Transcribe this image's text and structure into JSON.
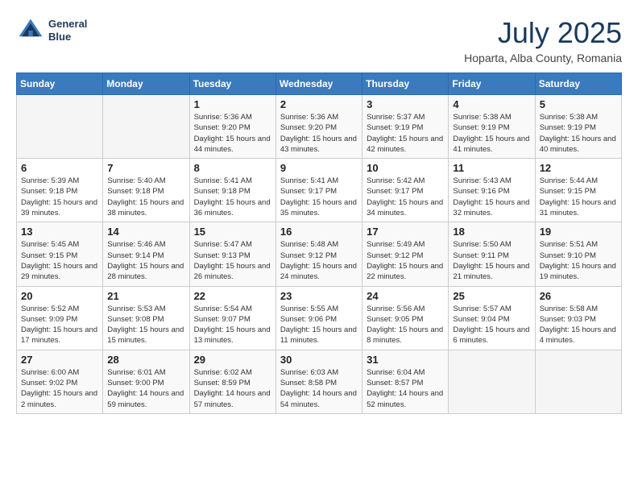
{
  "header": {
    "logo": {
      "line1": "General",
      "line2": "Blue"
    },
    "month": "July 2025",
    "location": "Hoparta, Alba County, Romania"
  },
  "weekdays": [
    "Sunday",
    "Monday",
    "Tuesday",
    "Wednesday",
    "Thursday",
    "Friday",
    "Saturday"
  ],
  "weeks": [
    [
      {
        "day": "",
        "sunrise": "",
        "sunset": "",
        "daylight": ""
      },
      {
        "day": "",
        "sunrise": "",
        "sunset": "",
        "daylight": ""
      },
      {
        "day": "1",
        "sunrise": "Sunrise: 5:36 AM",
        "sunset": "Sunset: 9:20 PM",
        "daylight": "Daylight: 15 hours and 44 minutes."
      },
      {
        "day": "2",
        "sunrise": "Sunrise: 5:36 AM",
        "sunset": "Sunset: 9:20 PM",
        "daylight": "Daylight: 15 hours and 43 minutes."
      },
      {
        "day": "3",
        "sunrise": "Sunrise: 5:37 AM",
        "sunset": "Sunset: 9:19 PM",
        "daylight": "Daylight: 15 hours and 42 minutes."
      },
      {
        "day": "4",
        "sunrise": "Sunrise: 5:38 AM",
        "sunset": "Sunset: 9:19 PM",
        "daylight": "Daylight: 15 hours and 41 minutes."
      },
      {
        "day": "5",
        "sunrise": "Sunrise: 5:38 AM",
        "sunset": "Sunset: 9:19 PM",
        "daylight": "Daylight: 15 hours and 40 minutes."
      }
    ],
    [
      {
        "day": "6",
        "sunrise": "Sunrise: 5:39 AM",
        "sunset": "Sunset: 9:18 PM",
        "daylight": "Daylight: 15 hours and 39 minutes."
      },
      {
        "day": "7",
        "sunrise": "Sunrise: 5:40 AM",
        "sunset": "Sunset: 9:18 PM",
        "daylight": "Daylight: 15 hours and 38 minutes."
      },
      {
        "day": "8",
        "sunrise": "Sunrise: 5:41 AM",
        "sunset": "Sunset: 9:18 PM",
        "daylight": "Daylight: 15 hours and 36 minutes."
      },
      {
        "day": "9",
        "sunrise": "Sunrise: 5:41 AM",
        "sunset": "Sunset: 9:17 PM",
        "daylight": "Daylight: 15 hours and 35 minutes."
      },
      {
        "day": "10",
        "sunrise": "Sunrise: 5:42 AM",
        "sunset": "Sunset: 9:17 PM",
        "daylight": "Daylight: 15 hours and 34 minutes."
      },
      {
        "day": "11",
        "sunrise": "Sunrise: 5:43 AM",
        "sunset": "Sunset: 9:16 PM",
        "daylight": "Daylight: 15 hours and 32 minutes."
      },
      {
        "day": "12",
        "sunrise": "Sunrise: 5:44 AM",
        "sunset": "Sunset: 9:15 PM",
        "daylight": "Daylight: 15 hours and 31 minutes."
      }
    ],
    [
      {
        "day": "13",
        "sunrise": "Sunrise: 5:45 AM",
        "sunset": "Sunset: 9:15 PM",
        "daylight": "Daylight: 15 hours and 29 minutes."
      },
      {
        "day": "14",
        "sunrise": "Sunrise: 5:46 AM",
        "sunset": "Sunset: 9:14 PM",
        "daylight": "Daylight: 15 hours and 28 minutes."
      },
      {
        "day": "15",
        "sunrise": "Sunrise: 5:47 AM",
        "sunset": "Sunset: 9:13 PM",
        "daylight": "Daylight: 15 hours and 26 minutes."
      },
      {
        "day": "16",
        "sunrise": "Sunrise: 5:48 AM",
        "sunset": "Sunset: 9:12 PM",
        "daylight": "Daylight: 15 hours and 24 minutes."
      },
      {
        "day": "17",
        "sunrise": "Sunrise: 5:49 AM",
        "sunset": "Sunset: 9:12 PM",
        "daylight": "Daylight: 15 hours and 22 minutes."
      },
      {
        "day": "18",
        "sunrise": "Sunrise: 5:50 AM",
        "sunset": "Sunset: 9:11 PM",
        "daylight": "Daylight: 15 hours and 21 minutes."
      },
      {
        "day": "19",
        "sunrise": "Sunrise: 5:51 AM",
        "sunset": "Sunset: 9:10 PM",
        "daylight": "Daylight: 15 hours and 19 minutes."
      }
    ],
    [
      {
        "day": "20",
        "sunrise": "Sunrise: 5:52 AM",
        "sunset": "Sunset: 9:09 PM",
        "daylight": "Daylight: 15 hours and 17 minutes."
      },
      {
        "day": "21",
        "sunrise": "Sunrise: 5:53 AM",
        "sunset": "Sunset: 9:08 PM",
        "daylight": "Daylight: 15 hours and 15 minutes."
      },
      {
        "day": "22",
        "sunrise": "Sunrise: 5:54 AM",
        "sunset": "Sunset: 9:07 PM",
        "daylight": "Daylight: 15 hours and 13 minutes."
      },
      {
        "day": "23",
        "sunrise": "Sunrise: 5:55 AM",
        "sunset": "Sunset: 9:06 PM",
        "daylight": "Daylight: 15 hours and 11 minutes."
      },
      {
        "day": "24",
        "sunrise": "Sunrise: 5:56 AM",
        "sunset": "Sunset: 9:05 PM",
        "daylight": "Daylight: 15 hours and 8 minutes."
      },
      {
        "day": "25",
        "sunrise": "Sunrise: 5:57 AM",
        "sunset": "Sunset: 9:04 PM",
        "daylight": "Daylight: 15 hours and 6 minutes."
      },
      {
        "day": "26",
        "sunrise": "Sunrise: 5:58 AM",
        "sunset": "Sunset: 9:03 PM",
        "daylight": "Daylight: 15 hours and 4 minutes."
      }
    ],
    [
      {
        "day": "27",
        "sunrise": "Sunrise: 6:00 AM",
        "sunset": "Sunset: 9:02 PM",
        "daylight": "Daylight: 15 hours and 2 minutes."
      },
      {
        "day": "28",
        "sunrise": "Sunrise: 6:01 AM",
        "sunset": "Sunset: 9:00 PM",
        "daylight": "Daylight: 14 hours and 59 minutes."
      },
      {
        "day": "29",
        "sunrise": "Sunrise: 6:02 AM",
        "sunset": "Sunset: 8:59 PM",
        "daylight": "Daylight: 14 hours and 57 minutes."
      },
      {
        "day": "30",
        "sunrise": "Sunrise: 6:03 AM",
        "sunset": "Sunset: 8:58 PM",
        "daylight": "Daylight: 14 hours and 54 minutes."
      },
      {
        "day": "31",
        "sunrise": "Sunrise: 6:04 AM",
        "sunset": "Sunset: 8:57 PM",
        "daylight": "Daylight: 14 hours and 52 minutes."
      },
      {
        "day": "",
        "sunrise": "",
        "sunset": "",
        "daylight": ""
      },
      {
        "day": "",
        "sunrise": "",
        "sunset": "",
        "daylight": ""
      }
    ]
  ]
}
